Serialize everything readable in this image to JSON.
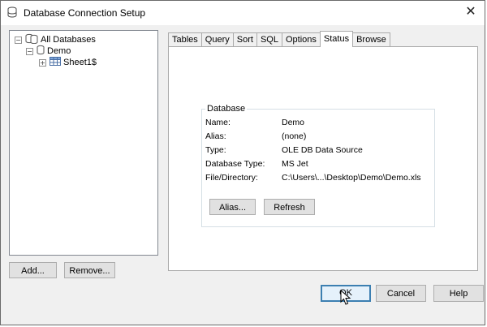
{
  "window": {
    "title": "Database Connection Setup",
    "close_symbol": "✕"
  },
  "tree": {
    "root": {
      "label": "All Databases",
      "toggle": "−"
    },
    "db": {
      "label": "Demo",
      "toggle": "−"
    },
    "table": {
      "label": "Sheet1$",
      "toggle": "+"
    }
  },
  "left_buttons": {
    "add": "Add...",
    "remove": "Remove..."
  },
  "tabs": [
    "Tables",
    "Query",
    "Sort",
    "SQL",
    "Options",
    "Status",
    "Browse"
  ],
  "active_tab": "Status",
  "status": {
    "group_title": "Database",
    "fields": [
      {
        "label": "Name:",
        "value": "Demo"
      },
      {
        "label": "Alias:",
        "value": "(none)"
      },
      {
        "label": "Type:",
        "value": "OLE DB Data Source"
      },
      {
        "label": "Database Type:",
        "value": "MS Jet"
      },
      {
        "label": "File/Directory:",
        "value": "C:\\Users\\...\\Desktop\\Demo\\Demo.xls"
      }
    ],
    "alias_button": "Alias...",
    "refresh_button": "Refresh"
  },
  "dialog_buttons": {
    "ok": "OK",
    "cancel": "Cancel",
    "help": "Help"
  }
}
